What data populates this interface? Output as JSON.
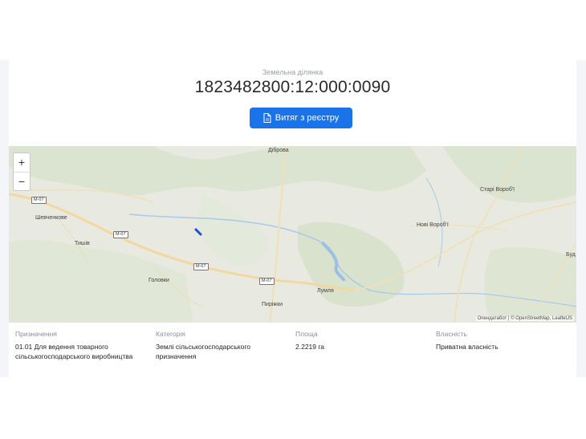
{
  "header": {
    "subtitle": "Земельна ділянка",
    "cadastral_number": "1823482800:12:000:0090",
    "extract_button_label": "Витяг з реєстру"
  },
  "map": {
    "zoom_in_label": "+",
    "zoom_out_label": "−",
    "places": [
      "Діброва",
      "Шевченкове",
      "Тишів",
      "Головки",
      "Пиріжки",
      "Лумля",
      "Нові Вороб'ї",
      "Старі Вороб'ї",
      "Буд"
    ],
    "road_shields": [
      "М-07",
      "М-07",
      "М-07",
      "М-07"
    ],
    "attribution": "Опендатабот | © OpenStreetMap, LeafletJS"
  },
  "info": {
    "fields": [
      {
        "label": "Призначення",
        "value": "01.01 Для ведення товарного сільськогосподарського виробництва"
      },
      {
        "label": "Категорія",
        "value": "Землі сільськогосподарського призначення"
      },
      {
        "label": "Площа",
        "value": "2.2219 га"
      },
      {
        "label": "Власність",
        "value": "Приватна власність"
      }
    ]
  }
}
